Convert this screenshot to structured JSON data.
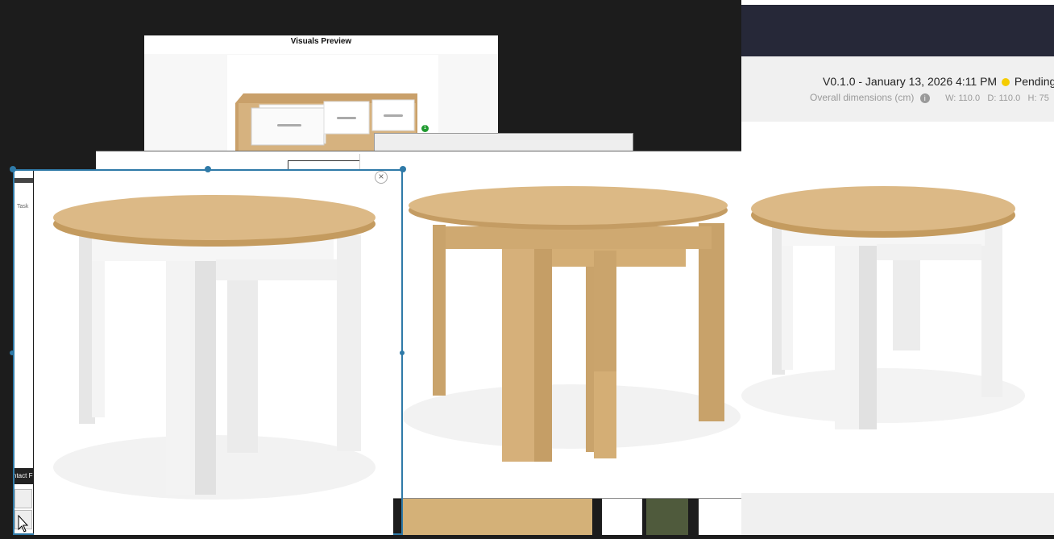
{
  "visuals_preview": {
    "title": "Visuals Preview",
    "badge": "1"
  },
  "overlay": {
    "task_label": "Task",
    "contact_label": "ntact F",
    "close_symbol": "×"
  },
  "right_panel": {
    "version_text": "V0.1.0 - January 13, 2026 4:11 PM",
    "status_text": "Pending",
    "status_color": "#f5cc00",
    "dims_label": "Overall dimensions (cm)",
    "dims_info_icon": "info-icon",
    "width_text": "W: 110.0",
    "depth_text": "D: 110.0",
    "height_text": "H: 75"
  },
  "colors": {
    "oak": "#d8b27a",
    "white_leg": "#f1f1f1",
    "navy": "#262838"
  }
}
